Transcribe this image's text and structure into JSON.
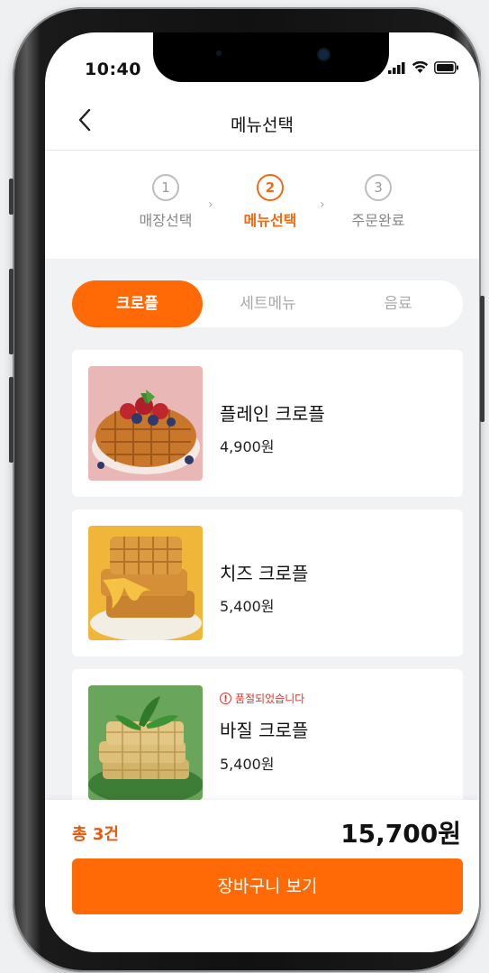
{
  "status": {
    "time": "10:40"
  },
  "header": {
    "title": "메뉴선택",
    "back_icon": "chevron-left-icon"
  },
  "steps": [
    {
      "num": "1",
      "label": "매장선택"
    },
    {
      "num": "2",
      "label": "메뉴선택"
    },
    {
      "num": "3",
      "label": "주문완료"
    }
  ],
  "tabs": [
    "크로플",
    "세트메뉴",
    "음료"
  ],
  "menu": [
    {
      "name": "플레인 크로플",
      "price": "4,900원"
    },
    {
      "name": "치즈 크로플",
      "price": "5,400원"
    },
    {
      "name": "바질 크로플",
      "price": "5,400원",
      "notice": "품절되었습니다"
    }
  ],
  "footer": {
    "count": "총 3건",
    "total": "15,700원",
    "cta": "장바구니 보기"
  },
  "colors": {
    "accent": "#ff6a06",
    "error": "#e0342c",
    "background": "#f1f2f4"
  }
}
